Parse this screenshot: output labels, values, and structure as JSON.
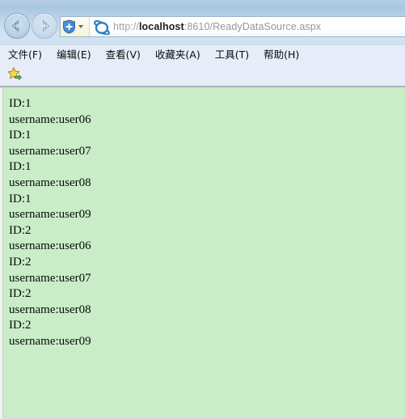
{
  "browser": {
    "nav": {
      "back_label": "Back",
      "forward_label": "Forward"
    },
    "address": {
      "url_scheme": "http://",
      "url_host": "localhost",
      "url_tail": ":8610/ReadyDataSource.aspx",
      "url_full": "http://localhost:8610/ReadyDataSource.aspx",
      "compat_icon": "compatibility-view-icon",
      "site_icon": "internet-explorer-logo-icon"
    },
    "menu": {
      "items": [
        {
          "label": "文件(F)"
        },
        {
          "label": "编辑(E)"
        },
        {
          "label": "查看(V)"
        },
        {
          "label": "收藏夹(A)"
        },
        {
          "label": "工具(T)"
        },
        {
          "label": "帮助(H)"
        }
      ]
    },
    "favorites_bar": {
      "star_icon": "favorites-star-icon"
    }
  },
  "page": {
    "background_color": "#c8edc7",
    "lines": [
      "ID:1",
      "username:user06",
      "ID:1",
      "username:user07",
      "ID:1",
      "username:user08",
      "ID:1",
      "username:user09",
      "ID:2",
      "username:user06",
      "ID:2",
      "username:user07",
      "ID:2",
      "username:user08",
      "ID:2",
      "username:user09"
    ]
  }
}
